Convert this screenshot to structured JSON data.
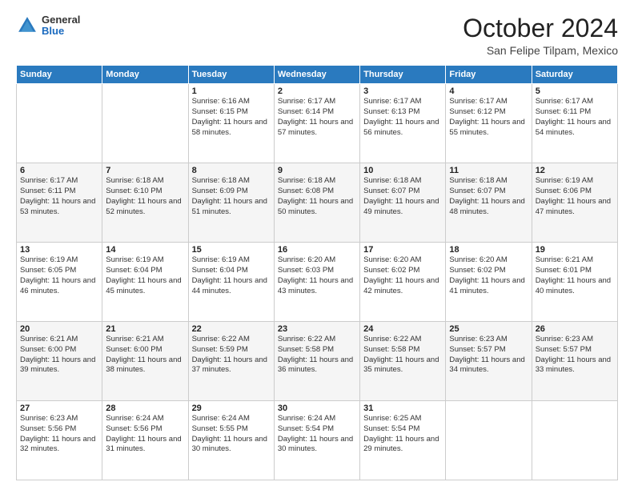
{
  "header": {
    "logo": {
      "general": "General",
      "blue": "Blue"
    },
    "title": "October 2024",
    "location": "San Felipe Tilpam, Mexico"
  },
  "calendar": {
    "days_of_week": [
      "Sunday",
      "Monday",
      "Tuesday",
      "Wednesday",
      "Thursday",
      "Friday",
      "Saturday"
    ],
    "rows": [
      [
        {
          "day": "",
          "info": ""
        },
        {
          "day": "",
          "info": ""
        },
        {
          "day": "1",
          "info": "Sunrise: 6:16 AM\nSunset: 6:15 PM\nDaylight: 11 hours and 58 minutes."
        },
        {
          "day": "2",
          "info": "Sunrise: 6:17 AM\nSunset: 6:14 PM\nDaylight: 11 hours and 57 minutes."
        },
        {
          "day": "3",
          "info": "Sunrise: 6:17 AM\nSunset: 6:13 PM\nDaylight: 11 hours and 56 minutes."
        },
        {
          "day": "4",
          "info": "Sunrise: 6:17 AM\nSunset: 6:12 PM\nDaylight: 11 hours and 55 minutes."
        },
        {
          "day": "5",
          "info": "Sunrise: 6:17 AM\nSunset: 6:11 PM\nDaylight: 11 hours and 54 minutes."
        }
      ],
      [
        {
          "day": "6",
          "info": "Sunrise: 6:17 AM\nSunset: 6:11 PM\nDaylight: 11 hours and 53 minutes."
        },
        {
          "day": "7",
          "info": "Sunrise: 6:18 AM\nSunset: 6:10 PM\nDaylight: 11 hours and 52 minutes."
        },
        {
          "day": "8",
          "info": "Sunrise: 6:18 AM\nSunset: 6:09 PM\nDaylight: 11 hours and 51 minutes."
        },
        {
          "day": "9",
          "info": "Sunrise: 6:18 AM\nSunset: 6:08 PM\nDaylight: 11 hours and 50 minutes."
        },
        {
          "day": "10",
          "info": "Sunrise: 6:18 AM\nSunset: 6:07 PM\nDaylight: 11 hours and 49 minutes."
        },
        {
          "day": "11",
          "info": "Sunrise: 6:18 AM\nSunset: 6:07 PM\nDaylight: 11 hours and 48 minutes."
        },
        {
          "day": "12",
          "info": "Sunrise: 6:19 AM\nSunset: 6:06 PM\nDaylight: 11 hours and 47 minutes."
        }
      ],
      [
        {
          "day": "13",
          "info": "Sunrise: 6:19 AM\nSunset: 6:05 PM\nDaylight: 11 hours and 46 minutes."
        },
        {
          "day": "14",
          "info": "Sunrise: 6:19 AM\nSunset: 6:04 PM\nDaylight: 11 hours and 45 minutes."
        },
        {
          "day": "15",
          "info": "Sunrise: 6:19 AM\nSunset: 6:04 PM\nDaylight: 11 hours and 44 minutes."
        },
        {
          "day": "16",
          "info": "Sunrise: 6:20 AM\nSunset: 6:03 PM\nDaylight: 11 hours and 43 minutes."
        },
        {
          "day": "17",
          "info": "Sunrise: 6:20 AM\nSunset: 6:02 PM\nDaylight: 11 hours and 42 minutes."
        },
        {
          "day": "18",
          "info": "Sunrise: 6:20 AM\nSunset: 6:02 PM\nDaylight: 11 hours and 41 minutes."
        },
        {
          "day": "19",
          "info": "Sunrise: 6:21 AM\nSunset: 6:01 PM\nDaylight: 11 hours and 40 minutes."
        }
      ],
      [
        {
          "day": "20",
          "info": "Sunrise: 6:21 AM\nSunset: 6:00 PM\nDaylight: 11 hours and 39 minutes."
        },
        {
          "day": "21",
          "info": "Sunrise: 6:21 AM\nSunset: 6:00 PM\nDaylight: 11 hours and 38 minutes."
        },
        {
          "day": "22",
          "info": "Sunrise: 6:22 AM\nSunset: 5:59 PM\nDaylight: 11 hours and 37 minutes."
        },
        {
          "day": "23",
          "info": "Sunrise: 6:22 AM\nSunset: 5:58 PM\nDaylight: 11 hours and 36 minutes."
        },
        {
          "day": "24",
          "info": "Sunrise: 6:22 AM\nSunset: 5:58 PM\nDaylight: 11 hours and 35 minutes."
        },
        {
          "day": "25",
          "info": "Sunrise: 6:23 AM\nSunset: 5:57 PM\nDaylight: 11 hours and 34 minutes."
        },
        {
          "day": "26",
          "info": "Sunrise: 6:23 AM\nSunset: 5:57 PM\nDaylight: 11 hours and 33 minutes."
        }
      ],
      [
        {
          "day": "27",
          "info": "Sunrise: 6:23 AM\nSunset: 5:56 PM\nDaylight: 11 hours and 32 minutes."
        },
        {
          "day": "28",
          "info": "Sunrise: 6:24 AM\nSunset: 5:56 PM\nDaylight: 11 hours and 31 minutes."
        },
        {
          "day": "29",
          "info": "Sunrise: 6:24 AM\nSunset: 5:55 PM\nDaylight: 11 hours and 30 minutes."
        },
        {
          "day": "30",
          "info": "Sunrise: 6:24 AM\nSunset: 5:54 PM\nDaylight: 11 hours and 30 minutes."
        },
        {
          "day": "31",
          "info": "Sunrise: 6:25 AM\nSunset: 5:54 PM\nDaylight: 11 hours and 29 minutes."
        },
        {
          "day": "",
          "info": ""
        },
        {
          "day": "",
          "info": ""
        }
      ]
    ]
  }
}
